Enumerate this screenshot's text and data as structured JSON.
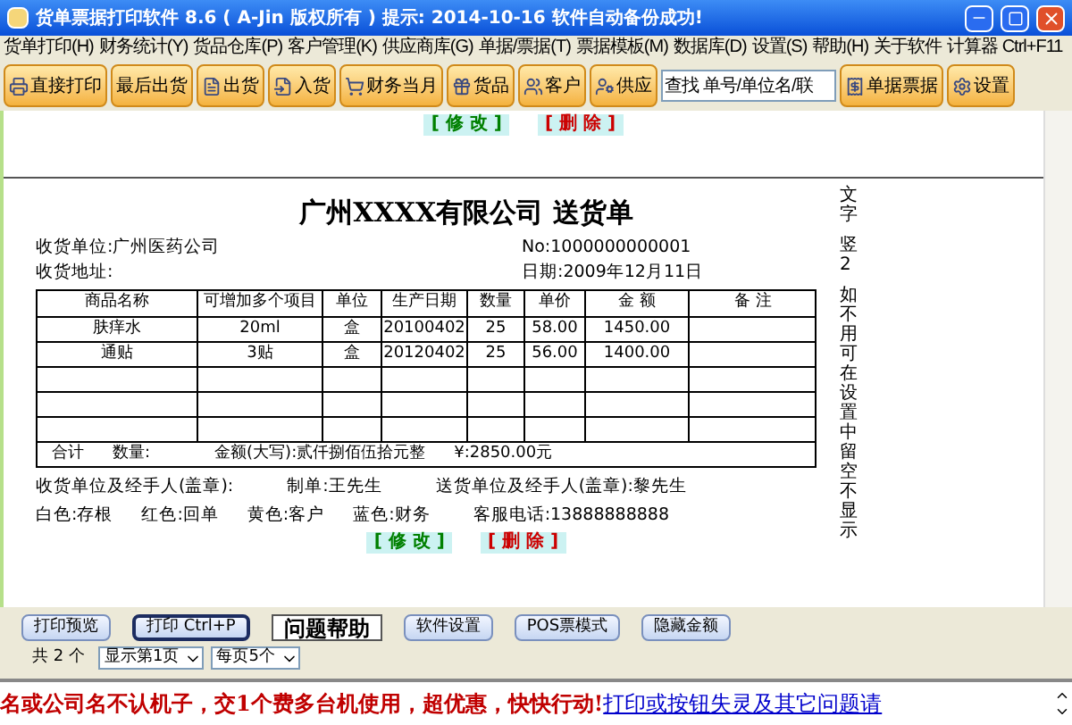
{
  "window": {
    "title": "货单票据打印软件 8.6 ( A-Jin 版权所有 )  提示: 2014-10-16 软件自动备份成功!"
  },
  "menu": [
    "货单打印(H)",
    "财务统计(Y)",
    "货品仓库(P)",
    "客户管理(K)",
    "供应商库(G)",
    "单据/票据(T)",
    "票据模板(M)",
    "数据库(D)",
    "设置(S)",
    "帮助(H)",
    "关于软件",
    "计算器 Ctrl+F11"
  ],
  "toolbar": [
    {
      "kind": "button",
      "label": "直接打印"
    },
    {
      "kind": "button",
      "label": "最后出货"
    },
    {
      "kind": "button",
      "label": "出货"
    },
    {
      "kind": "button",
      "label": "入货"
    },
    {
      "kind": "button",
      "label": "财务当月"
    },
    {
      "kind": "button",
      "label": "货品"
    },
    {
      "kind": "button",
      "label": "客户"
    },
    {
      "kind": "button",
      "label": "供应"
    },
    {
      "kind": "search",
      "placeholder": "查找 单号/单位名/联"
    },
    {
      "kind": "button",
      "label": "单据票据"
    },
    {
      "kind": "button",
      "label": "设置"
    }
  ],
  "document": {
    "top_actions": [
      {
        "kind": "edit",
        "label": "[ 修 改 ]"
      },
      {
        "kind": "delete",
        "label": "[ 删 除 ]"
      }
    ],
    "title": "广州XXXX有限公司 送货单",
    "recipient": "收货单位:广州医药公司",
    "number": "No:1000000000001",
    "address": "收货地址:",
    "date": "日期:2009年12月11日",
    "table": {
      "columns": [
        "商品名称",
        "可增加多个项目",
        "单位",
        "生产日期",
        "数量",
        "单价",
        "金 额",
        "备 注"
      ],
      "rows": [
        [
          "肤痒水",
          "20ml",
          "盒",
          "20100402",
          "25",
          "58.00",
          "1450.00",
          ""
        ],
        [
          "通贴",
          "3贴",
          "盒",
          "20120402",
          "25",
          "56.00",
          "1400.00",
          ""
        ]
      ],
      "totals": [
        "合计",
        "数量:",
        "金额(大写):贰仟捌佰伍拾元整",
        "¥:2850.00元"
      ]
    },
    "signatures": [
      "收货单位及经手人(盖章):",
      "制单:王先生",
      "送货单位及经手人(盖章):黎先生"
    ],
    "copies": [
      "白色:存根",
      "红色:回单",
      "黄色:客户",
      "蓝色:财务",
      "客服电话:13888888888"
    ],
    "bottom_actions": [
      {
        "kind": "edit",
        "label": "[ 修 改 ]"
      },
      {
        "kind": "delete",
        "label": "[ 删 除 ]"
      }
    ],
    "side_note": [
      "文字",
      "竖2",
      "如不用可在设置中留空不显示"
    ]
  },
  "buttons": [
    {
      "kind": "plain",
      "label": "打印预览",
      "focused": false
    },
    {
      "kind": "plain",
      "label": "打印 Ctrl+P",
      "focused": true
    },
    {
      "kind": "help",
      "label": "问题帮助",
      "focused": false
    },
    {
      "kind": "plain",
      "label": "软件设置",
      "focused": false
    },
    {
      "kind": "plain",
      "label": "POS票模式",
      "focused": false
    },
    {
      "kind": "plain",
      "label": "隐藏金额",
      "focused": false
    }
  ],
  "pager": {
    "count": "共 2 个",
    "selects": [
      "显示第1页",
      "每页5个"
    ]
  },
  "marquee": {
    "text": "名或公司名不认机子，交1个费多台机使用，超优惠，快快行动!",
    "link": "打印或按钮失灵及其它问题请"
  }
}
